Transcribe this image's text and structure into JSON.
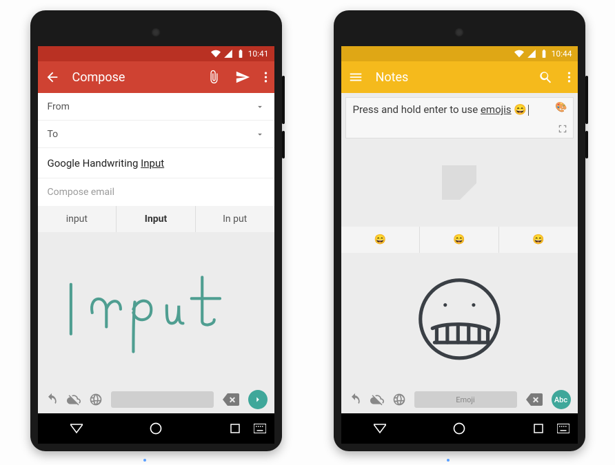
{
  "phone1": {
    "status_time": "10:41",
    "appbar": {
      "title": "Compose"
    },
    "from_label": "From",
    "to_label": "To",
    "subject_prefix": "Google Handwriting ",
    "subject_under": "Input",
    "body_placeholder": "Compose email",
    "suggestions": [
      "input",
      "Input",
      "In put"
    ],
    "spacebar_label": "",
    "go_label": ""
  },
  "phone2": {
    "status_time": "10:44",
    "appbar": {
      "title": "Notes"
    },
    "note_text_prefix": "Press and hold enter to use ",
    "note_text_under": "emojis",
    "note_emoji": "😄",
    "suggestions": [
      "😄",
      "😄",
      "😄"
    ],
    "spacebar_label": "Emoji",
    "go_label": "Abc"
  }
}
